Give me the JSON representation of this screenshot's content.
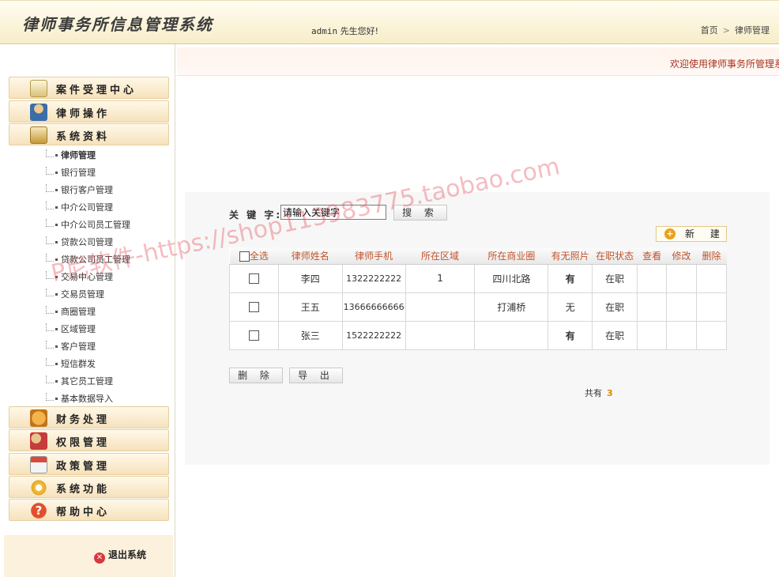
{
  "header": {
    "app_title": "律师事务所信息管理系统",
    "welcome_user": "admin",
    "welcome_text": "先生您好!",
    "breadcrumb_home": "首页",
    "breadcrumb_current": "律师管理"
  },
  "sidebar": {
    "sections_top": [
      {
        "label": "案件受理中心",
        "icon": "case-icon"
      },
      {
        "label": "律师操作",
        "icon": "lawyer-icon"
      },
      {
        "label": "系统资料",
        "icon": "system-data-icon"
      }
    ],
    "sub_items": [
      "律师管理",
      "银行管理",
      "银行客户管理",
      "中介公司管理",
      "中介公司员工管理",
      "贷款公司管理",
      "贷款公司员工管理",
      "交易中心管理",
      "交易员管理",
      "商圈管理",
      "区域管理",
      "客户管理",
      "短信群发",
      "其它员工管理",
      "基本数据导入"
    ],
    "sections_bottom": [
      {
        "label": "财务处理",
        "icon": "finance-icon"
      },
      {
        "label": "权限管理",
        "icon": "permission-icon"
      },
      {
        "label": "政策管理",
        "icon": "policy-icon"
      },
      {
        "label": "系统功能",
        "icon": "gear-icon"
      },
      {
        "label": "帮助中心",
        "icon": "help-icon"
      }
    ],
    "logout_label": "退出系统"
  },
  "marquee": {
    "text": "欢迎使用律师事务所管理系统"
  },
  "search": {
    "keyword_label": "关 键 字:",
    "keyword_value": "请输入关键字",
    "search_label": "搜 索",
    "new_label": "新 建"
  },
  "table": {
    "select_all_label": "全选",
    "headers": [
      "律师姓名",
      "律师手机",
      "所在区域",
      "所在商业圈",
      "有无照片",
      "在职状态",
      "查看",
      "修改",
      "删除"
    ],
    "rows": [
      {
        "name": "李四",
        "phone": "1322222222",
        "area": "1",
        "district": "四川北路",
        "photo": "有",
        "status": "在职"
      },
      {
        "name": "王五",
        "phone": "13666666666",
        "area": "",
        "district": "打浦桥",
        "photo": "无",
        "status": "在职"
      },
      {
        "name": "张三",
        "phone": "1522222222",
        "area": "",
        "district": "",
        "photo": "有",
        "status": "在职"
      }
    ]
  },
  "footer": {
    "delete_label": "删 除",
    "export_label": "导 出",
    "total_label": "共有",
    "total_count": "3"
  },
  "watermark": {
    "text": "P尼软件-https://shop113983775.taobao.com"
  },
  "colors": {
    "header_bg": "#f7edc9",
    "menu_head_bg": "#f6e2bc",
    "table_header_text": "#c1552d",
    "photo_yes": "#b00000",
    "total_count": "#d68b00"
  }
}
